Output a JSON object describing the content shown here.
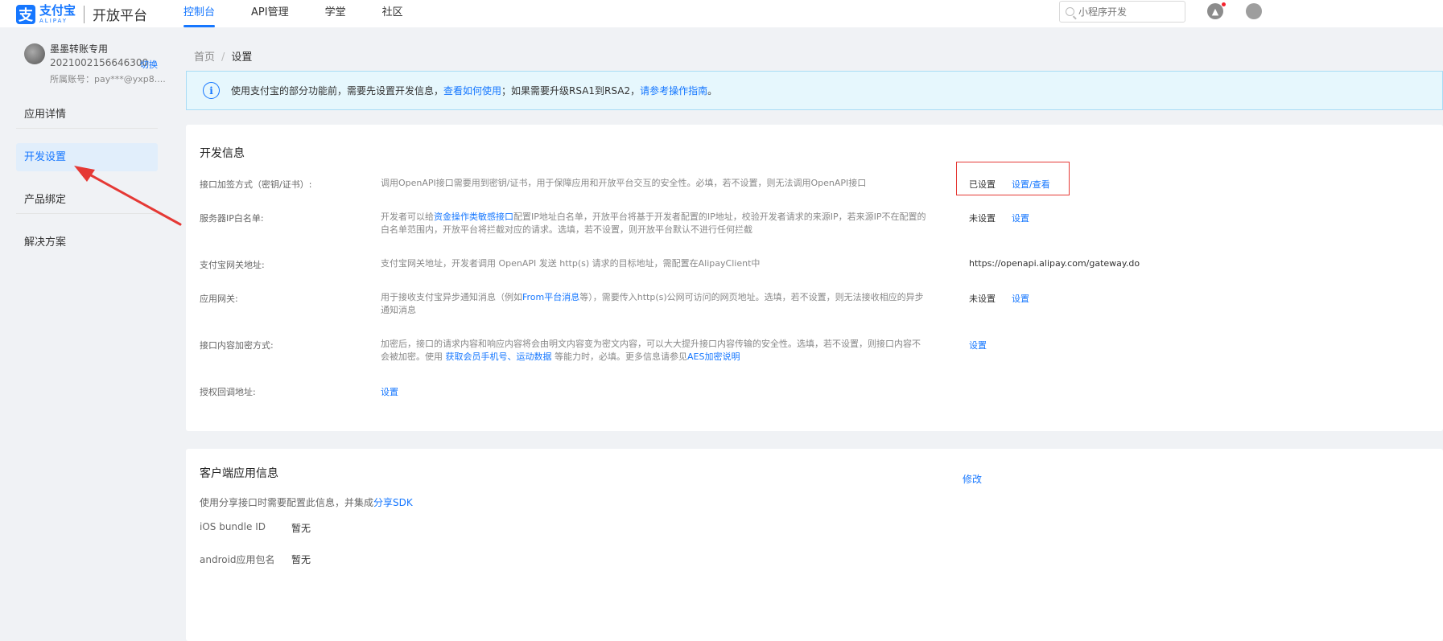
{
  "header": {
    "logo_cn": "支付宝",
    "logo_en": "ALIPAY",
    "platform": "开放平台",
    "nav": [
      "控制台",
      "API管理",
      "学堂",
      "社区"
    ],
    "search_placeholder": "小程序开发"
  },
  "account": {
    "name": "墨墨转账专用",
    "id": "2021002156646300",
    "switch_label": "切换",
    "owner": "所属账号：pay***@yxp8...."
  },
  "sidebar": {
    "items": [
      "应用详情",
      "开发设置",
      "产品绑定",
      "解决方案"
    ]
  },
  "breadcrumb": {
    "home": "首页",
    "sep": "/",
    "current": "设置"
  },
  "notice": {
    "text1": "使用支付宝的部分功能前，需要先设置开发信息，",
    "link1": "查看如何使用",
    "text2": "；如果需要升级RSA1到RSA2，",
    "link2": "请参考操作指南",
    "text3": "。"
  },
  "dev_info": {
    "title": "开发信息",
    "rows": [
      {
        "label": "接口加签方式（密钥/证书）:",
        "desc": "调用OpenAPI接口需要用到密钥/证书，用于保障应用和开放平台交互的安全性。必填，若不设置，则无法调用OpenAPI接口",
        "status": "已设置",
        "action": "设置/查看"
      },
      {
        "label": "服务器IP白名单:",
        "desc_a": "开发者可以给",
        "desc_link": "资金操作类敏感接口",
        "desc_b": "配置IP地址白名单，开放平台将基于开发者配置的IP地址，校验开发者请求的来源IP，若来源IP不在配置的白名单范围内，开放平台将拦截对应的请求。选填，若不设置，则开放平台默认不进行任何拦截",
        "status": "未设置",
        "action": "设置"
      },
      {
        "label": "支付宝网关地址:",
        "desc": "支付宝网关地址，开发者调用 OpenAPI 发送 http(s) 请求的目标地址，需配置在AlipayClient中",
        "status": "https://openapi.alipay.com/gateway.do"
      },
      {
        "label": "应用网关:",
        "desc_a": "用于接收支付宝异步通知消息（例如",
        "desc_link": "From平台消息",
        "desc_b": "等），需要传入http(s)公网可访问的网页地址。选填，若不设置，则无法接收相应的异步通知消息",
        "status": "未设置",
        "action": "设置"
      },
      {
        "label": "接口内容加密方式:",
        "desc_a": "加密后，接口的请求内容和响应内容将会由明文内容变为密文内容，可以大大提升接口内容传输的安全性。选填，若不设置，则接口内容不会被加密。使用 ",
        "desc_link1": "获取会员手机号",
        "desc_mid": "、",
        "desc_link2": "运动数据",
        "desc_b": " 等能力时，必填。更多信息请参见",
        "desc_link3": "AES加密说明",
        "action": "设置"
      },
      {
        "label": "授权回调地址:",
        "action": "设置"
      }
    ]
  },
  "client_info": {
    "title": "客户端应用信息",
    "edit": "修改",
    "desc": "使用分享接口时需要配置此信息，并集成",
    "desc_link": "分享SDK",
    "rows": [
      {
        "label": "iOS bundle ID",
        "value": "暂无"
      },
      {
        "label": "android应用包名",
        "value": "暂无"
      }
    ]
  }
}
